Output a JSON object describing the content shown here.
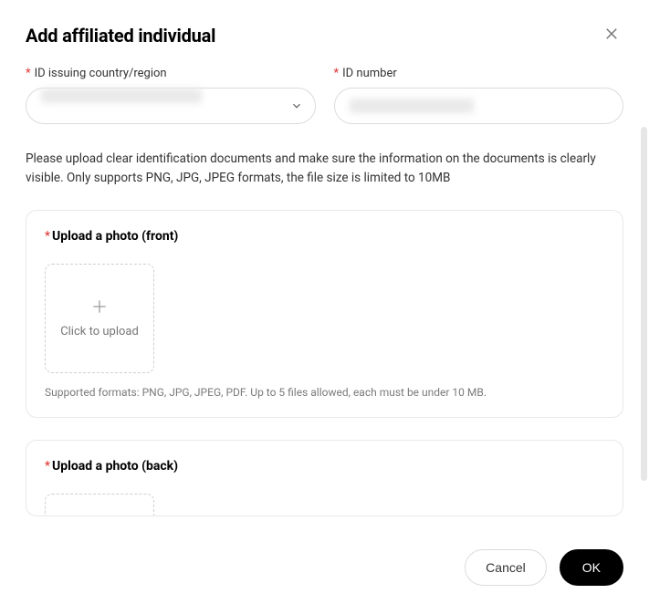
{
  "modal": {
    "title": "Add affiliated individual"
  },
  "fields": {
    "country_label": "ID issuing country/region",
    "idnumber_label": "ID number"
  },
  "info_text": "Please upload clear identification documents and make sure the information on the documents is clearly visible. Only supports PNG, JPG, JPEG formats, the file size is limited to 10MB",
  "upload_front": {
    "label": "Upload a photo (front)",
    "button": "Click to upload",
    "support": "Supported formats: PNG, JPG, JPEG, PDF. Up to 5 files allowed, each must be under 10 MB."
  },
  "upload_back": {
    "label": "Upload a photo (back)"
  },
  "footer": {
    "cancel": "Cancel",
    "ok": "OK"
  }
}
